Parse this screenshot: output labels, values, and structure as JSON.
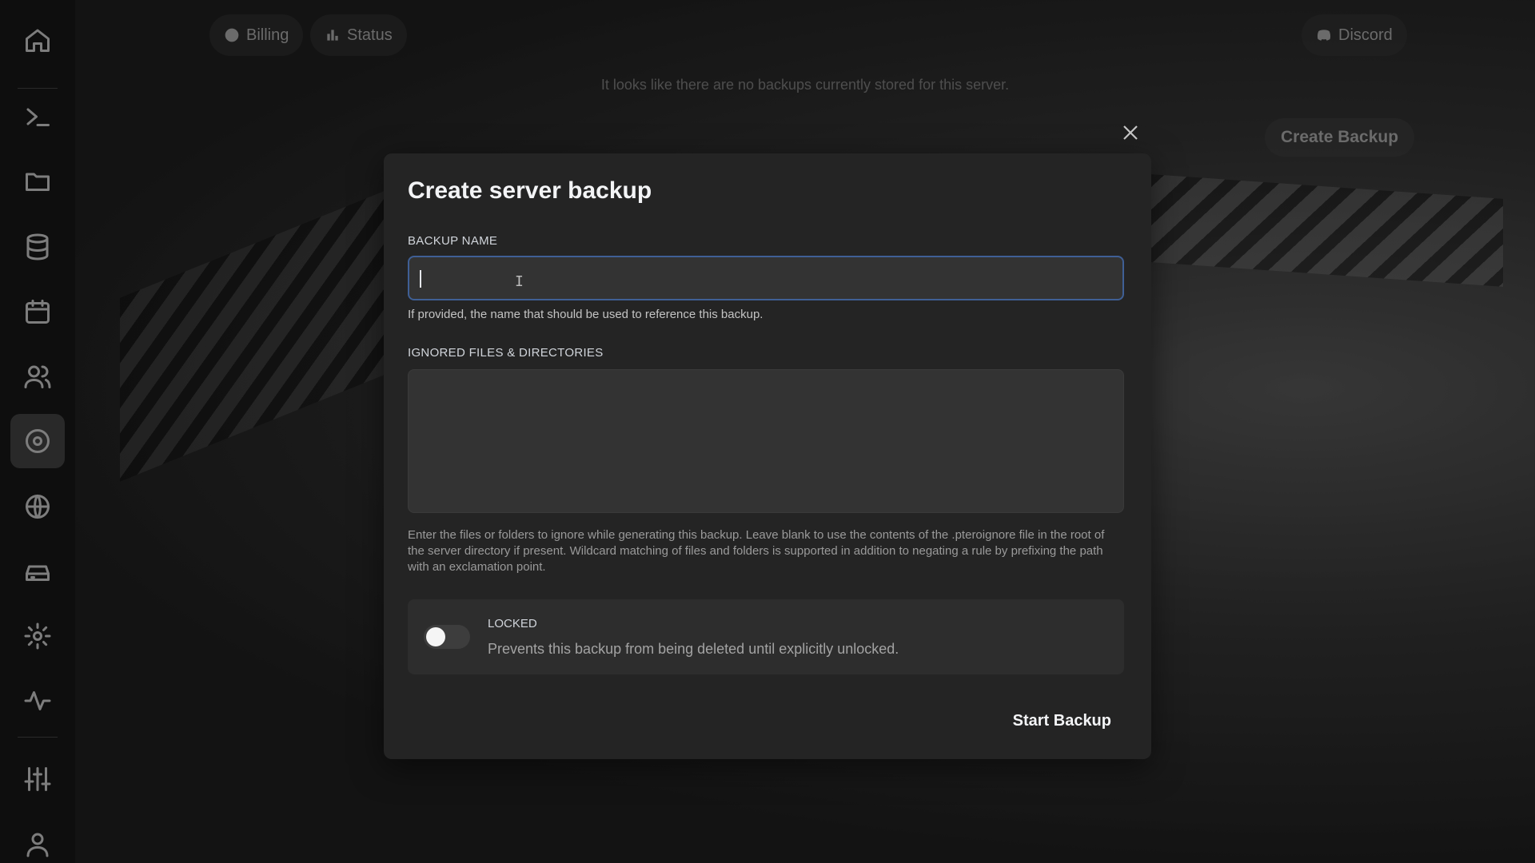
{
  "topnav": {
    "billing_label": "Billing",
    "status_label": "Status",
    "discord_label": "Discord"
  },
  "page": {
    "empty_message": "It looks like there are no backups currently stored for this server.",
    "create_backup_label": "Create Backup"
  },
  "sidebar": {
    "items": [
      {
        "icon": "home-icon"
      },
      {
        "icon": "terminal-icon"
      },
      {
        "icon": "folder-icon"
      },
      {
        "icon": "database-icon"
      },
      {
        "icon": "calendar-icon"
      },
      {
        "icon": "users-icon"
      },
      {
        "icon": "backup-icon",
        "active": true
      },
      {
        "icon": "globe-icon"
      },
      {
        "icon": "hard-drive-icon"
      },
      {
        "icon": "gear-icon"
      },
      {
        "icon": "activity-icon"
      },
      {
        "icon": "sliders-icon"
      },
      {
        "icon": "user-icon"
      }
    ]
  },
  "modal": {
    "title": "Create server backup",
    "backup_name_label": "Backup Name",
    "backup_name_value": "",
    "backup_name_help": "If provided, the name that should be used to reference this backup.",
    "ignored_label": "Ignored Files & Directories",
    "ignored_value": "",
    "ignored_help": "Enter the files or folders to ignore while generating this backup. Leave blank to use the contents of the .pteroignore file in the root of the server directory if present. Wildcard matching of files and folders is supported in addition to negating a rule by prefixing the path with an exclamation point.",
    "locked_label": "Locked",
    "locked_description": "Prevents this backup from being deleted until explicitly unlocked.",
    "locked_on": false,
    "start_label": "Start Backup"
  },
  "colors": {
    "input_focus_border": "#3f5f95",
    "modal_bg": "#242424"
  }
}
